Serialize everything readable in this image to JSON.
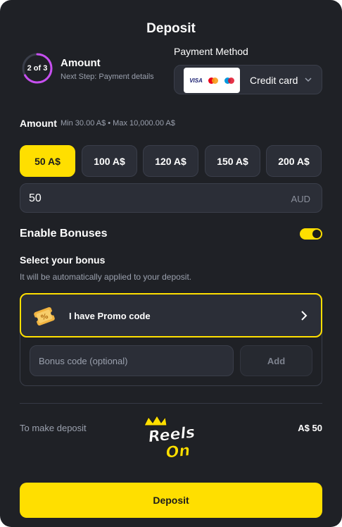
{
  "header": {
    "title": "Deposit"
  },
  "step": {
    "indicator": "2 of 3",
    "progress": 0.667,
    "title": "Amount",
    "subtitle": "Next Step: Payment details"
  },
  "payment_method": {
    "label": "Payment Method",
    "value": "Credit card",
    "logos": {
      "visa": "VISA"
    }
  },
  "amount": {
    "label": "Amount",
    "hint": "Min 30.00 A$ • Max 10,000.00 A$",
    "chips": [
      "50 A$",
      "100 A$",
      "120 A$",
      "150 A$",
      "200 A$"
    ],
    "selected_index": 0,
    "input_value": "50",
    "currency": "AUD"
  },
  "bonus": {
    "label": "Enable Bonuses",
    "enabled": true,
    "select_title": "Select your bonus",
    "select_subtitle": "It will be automatically applied to your deposit.",
    "promo_label": "I have Promo code",
    "code_placeholder": "Bonus code (optional)",
    "add_label": "Add"
  },
  "summary": {
    "label": "To make deposit",
    "total": "A$ 50",
    "logo_text_1": "Reels",
    "logo_text_2": "On"
  },
  "footer": {
    "deposit_label": "Deposit"
  },
  "colors": {
    "accent": "#ffdf00",
    "ring": "#c74ff0",
    "background": "#1f2126",
    "field": "#2b2e37"
  }
}
